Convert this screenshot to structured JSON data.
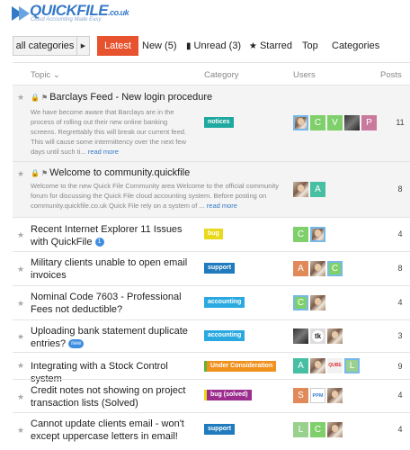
{
  "header": {
    "brand": "QUICKFILE",
    "tld": ".co.uk",
    "tagline": "Cloud Accounting Made Easy"
  },
  "nav": {
    "category_select": "all categories",
    "tabs": [
      {
        "label": "Latest",
        "active": true
      },
      {
        "label": "New (5)",
        "active": false
      },
      {
        "label": "Unread (3)",
        "active": false
      },
      {
        "label": "Starred",
        "active": false
      },
      {
        "label": "Top",
        "active": false
      },
      {
        "label": "Categories",
        "active": false
      }
    ]
  },
  "columns": {
    "topic": "Topic",
    "category": "Category",
    "users": "Users",
    "posts": "Posts"
  },
  "topics": [
    {
      "title": "Barclays Feed - New login procedure",
      "pinned": true,
      "excerpt": "We have become aware that Barclays are in the process of rolling out their new online banking screens. Regrettably this will break our current feed. This will cause some intermittency over the next few days until such ti...",
      "more": "read more",
      "category": "notices",
      "category_color": "#1fa89f",
      "users": [
        "S",
        "C",
        "V",
        "R",
        "P"
      ],
      "posts": "11"
    },
    {
      "title": "Welcome to community.quickfile",
      "pinned": true,
      "excerpt": "Welcome to the new Quick File Community area Welcome to the official community forum for discussing the Quick File cloud accounting system. Before posting on community.quickfile.co.uk Quick File rely on a system of ...",
      "more": "read more",
      "users": [
        "S",
        "A"
      ],
      "posts": "8"
    },
    {
      "title": "Recent Internet Explorer 11 Issues with QuickFile",
      "count_badge": "1",
      "category": "bug",
      "category_color": "#e9d81c",
      "users": [
        "C",
        "S"
      ],
      "posts": "4"
    },
    {
      "title": "Military clients unable to open email invoices",
      "category": "support",
      "category_color": "#1f7bbd",
      "users": [
        "A",
        "S",
        "C"
      ],
      "posts": "8"
    },
    {
      "title": "Nominal Code 7603 - Professional Fees not deductible?",
      "category": "accounting",
      "category_color": "#2aa9e0",
      "users": [
        "C",
        "S"
      ],
      "posts": "4"
    },
    {
      "title": "Uploading bank statement duplicate entries?",
      "new_badge": "new",
      "category": "accounting",
      "category_color": "#2aa9e0",
      "users": [
        "D",
        "tk",
        "S"
      ],
      "posts": "3"
    },
    {
      "title": "Integrating with a Stock Control system",
      "category": "Under Consideration",
      "category_color": "#f0921e",
      "category_bar": "#5fb336",
      "users": [
        "A",
        "S",
        "O",
        "L"
      ],
      "posts": "9"
    },
    {
      "title": "Credit notes not showing on project transaction lists (Solved)",
      "category": "bug (solved)",
      "category_color": "#9c2d8f",
      "category_bar": "#e9d81c",
      "users": [
        "S",
        "PPM",
        "S"
      ],
      "posts": "4"
    },
    {
      "title": "Cannot update clients email - won't except uppercase letters in email!",
      "category": "support",
      "category_color": "#1f7bbd",
      "users": [
        "L",
        "C",
        "S"
      ],
      "posts": "4"
    }
  ],
  "avatar_colors": {
    "C": "#7fd06b",
    "V": "#7fd06b",
    "P": "#c97a9c",
    "A": "#46bfa2",
    "L": "#9ad08e",
    "S": "#e08a5a",
    "O": "#efefef"
  }
}
